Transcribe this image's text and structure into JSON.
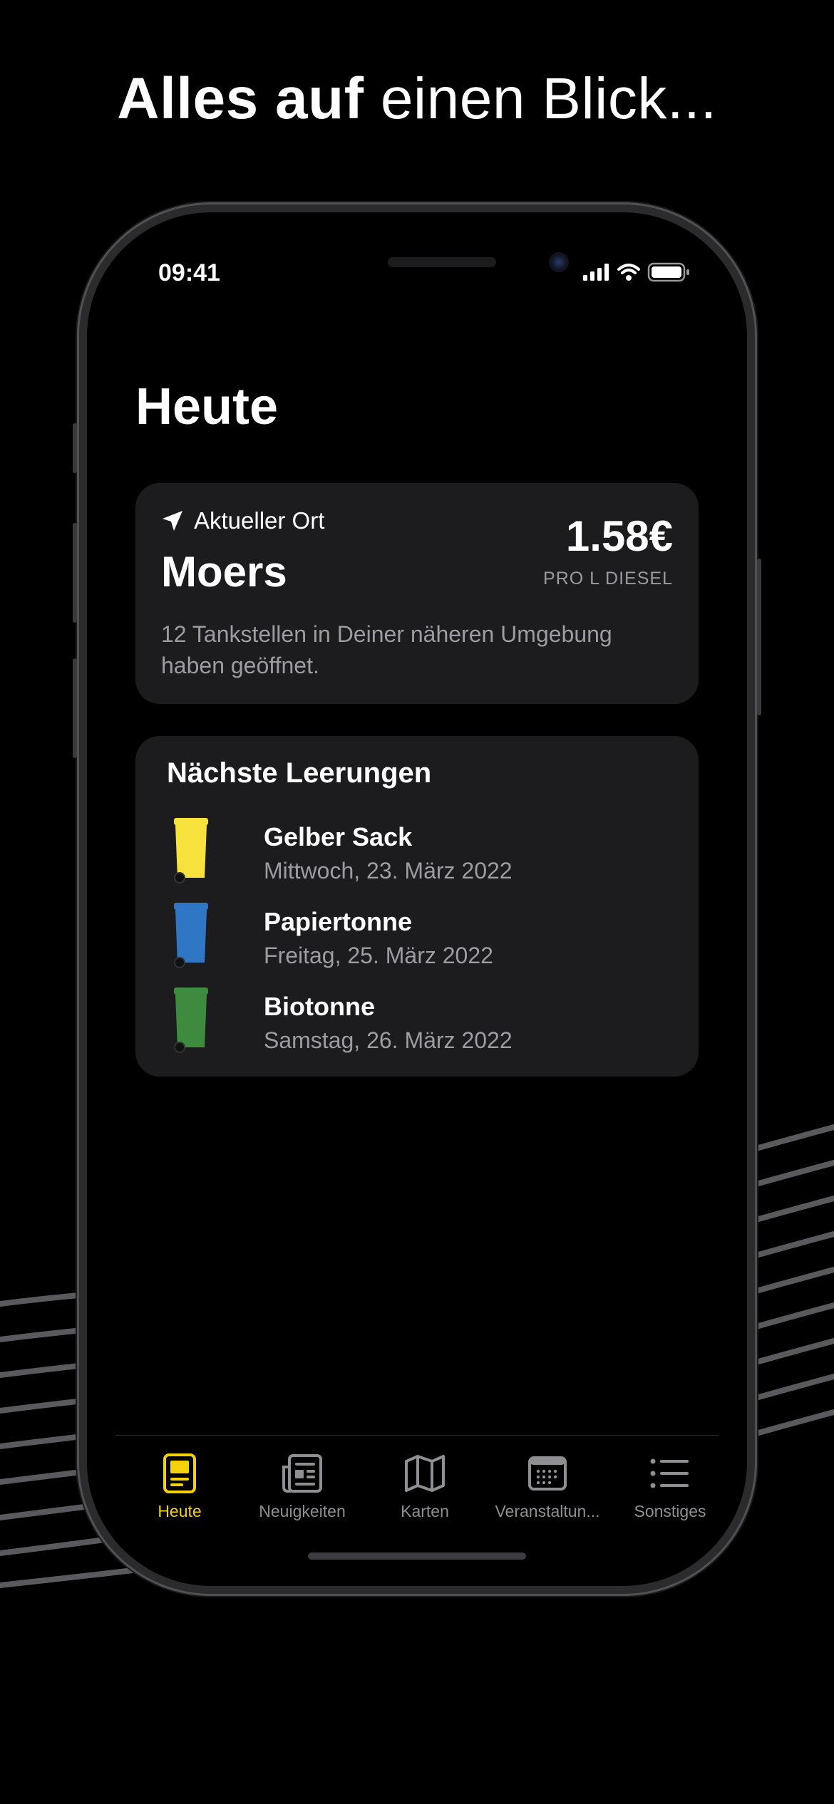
{
  "headline": {
    "bold": "Alles auf",
    "regular": " einen Blick..."
  },
  "status_bar": {
    "time": "09:41"
  },
  "page_title": "Heute",
  "location_card": {
    "location_label": "Aktueller Ort",
    "city": "Moers",
    "price": "1.58€",
    "price_label": "PRO L DIESEL",
    "description": "12 Tankstellen in Deiner näheren Umgebung haben geöffnet."
  },
  "pickups": {
    "title": "Nächste Leerungen",
    "items": [
      {
        "name": "Gelber Sack",
        "date": "Mittwoch, 23. März 2022",
        "color": "#f7e23d"
      },
      {
        "name": "Papiertonne",
        "date": "Freitag, 25. März 2022",
        "color": "#2f76c4"
      },
      {
        "name": "Biotonne",
        "date": "Samstag, 26. März 2022",
        "color": "#3e8a3e"
      }
    ]
  },
  "tabs": [
    {
      "label": "Heute",
      "icon": "today-icon",
      "active": true
    },
    {
      "label": "Neuigkeiten",
      "icon": "newspaper-icon",
      "active": false
    },
    {
      "label": "Karten",
      "icon": "map-icon",
      "active": false
    },
    {
      "label": "Veranstaltun...",
      "icon": "calendar-icon",
      "active": false
    },
    {
      "label": "Sonstiges",
      "icon": "list-icon",
      "active": false
    }
  ],
  "colors": {
    "accent": "#f5d10c",
    "card": "#1c1c1e",
    "secondary_text": "#9c9ca2"
  }
}
